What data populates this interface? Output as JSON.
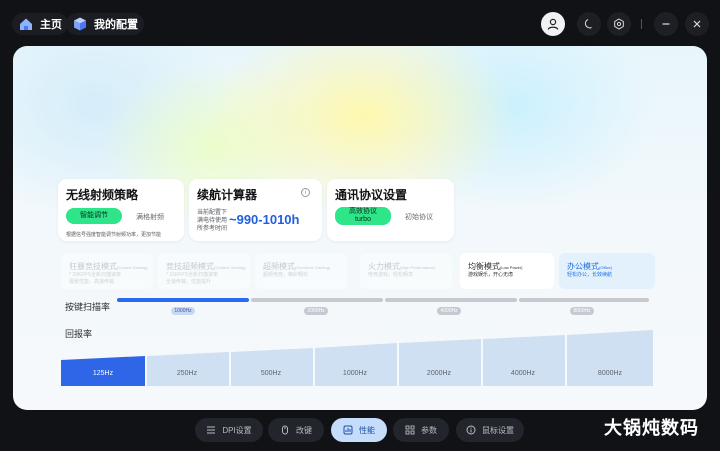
{
  "nav": {
    "home": "主页",
    "config": "我的配置"
  },
  "rf_card": {
    "title": "无线射频策略",
    "option_active": "智能调节",
    "option_inactive": "满格射频",
    "desc": "根据信号强度智能调节射频功率，更加节能"
  },
  "battery_card": {
    "title": "续航计算器",
    "desc_line1": "当前配置下",
    "desc_line2": "满电待使用",
    "desc_line3": "所参考时间",
    "value": "~990-1010h"
  },
  "comm_card": {
    "title": "通讯协议设置",
    "option_active_line1": "高效协议",
    "option_active_line2": "turbo",
    "option_inactive": "初始协议"
  },
  "modes": [
    {
      "title": "狂暴竞技模式",
      "sub": "(Crazed Gaming)",
      "desc1": "* 20KFPS全新扫描速率",
      "desc2": "极致性能，高速传输"
    },
    {
      "title": "竞技超频模式",
      "sub": "(Contest Gaming)",
      "desc1": "* 15KFPS全新扫描速率",
      "desc2": "全速传输，性能提升"
    },
    {
      "title": "超频模式",
      "sub": "(Overdrive Gaming)",
      "desc1": "超频电竞，精彩畅玩",
      "desc2": ""
    },
    {
      "title": "火力模式",
      "sub": "(High Performance)",
      "desc1": "电竞游戏，轻松畅享",
      "desc2": ""
    },
    {
      "title": "均衡模式",
      "sub": "(Low Power)",
      "desc1": "游戏娱乐，开心无虑",
      "desc2": ""
    },
    {
      "title": "办公模式",
      "sub": "(Office)",
      "desc1": "轻松办公，长效续航",
      "desc2": ""
    }
  ],
  "scan_rate": {
    "label": "按键扫描率",
    "ticks": [
      "1000Hz",
      "2000Hz",
      "4000Hz",
      "8000Hz"
    ],
    "selected_index": 0
  },
  "polling": {
    "label": "回报率",
    "options": [
      "125Hz",
      "250Hz",
      "500Hz",
      "1000Hz",
      "2000Hz",
      "4000Hz",
      "8000Hz"
    ],
    "selected_index": 0
  },
  "tabs": [
    {
      "label": "DPI设置",
      "icon": "dpi-icon"
    },
    {
      "label": "改键",
      "icon": "mouse-icon"
    },
    {
      "label": "性能",
      "icon": "performance-icon"
    },
    {
      "label": "参数",
      "icon": "grid-icon"
    },
    {
      "label": "鼠标设置",
      "icon": "info-icon"
    }
  ],
  "watermark": "大锅炖数码",
  "colors": {
    "accent_blue": "#2a6af0",
    "accent_green": "#2ee58a",
    "active_tab": "#c5dcfa"
  }
}
